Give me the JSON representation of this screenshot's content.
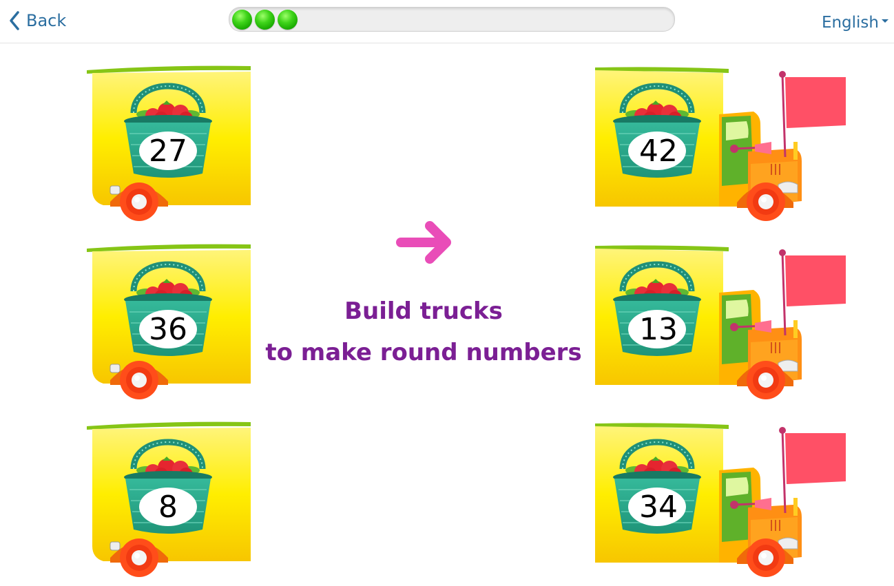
{
  "header": {
    "back_label": "Back",
    "language_label": "English",
    "progress_dots": 3
  },
  "instruction": {
    "line1": "Build trucks",
    "line2": "to make round numbers"
  },
  "trucks": {
    "backs": [
      "27",
      "36",
      "8"
    ],
    "fronts": [
      "42",
      "13",
      "34"
    ]
  },
  "colors": {
    "link": "#2b6ea0",
    "instruction": "#7b1f94",
    "arrow": "#e94db8",
    "truck_body": "#fff000",
    "basket": "#2aa88a",
    "flag": "#ff5066"
  }
}
